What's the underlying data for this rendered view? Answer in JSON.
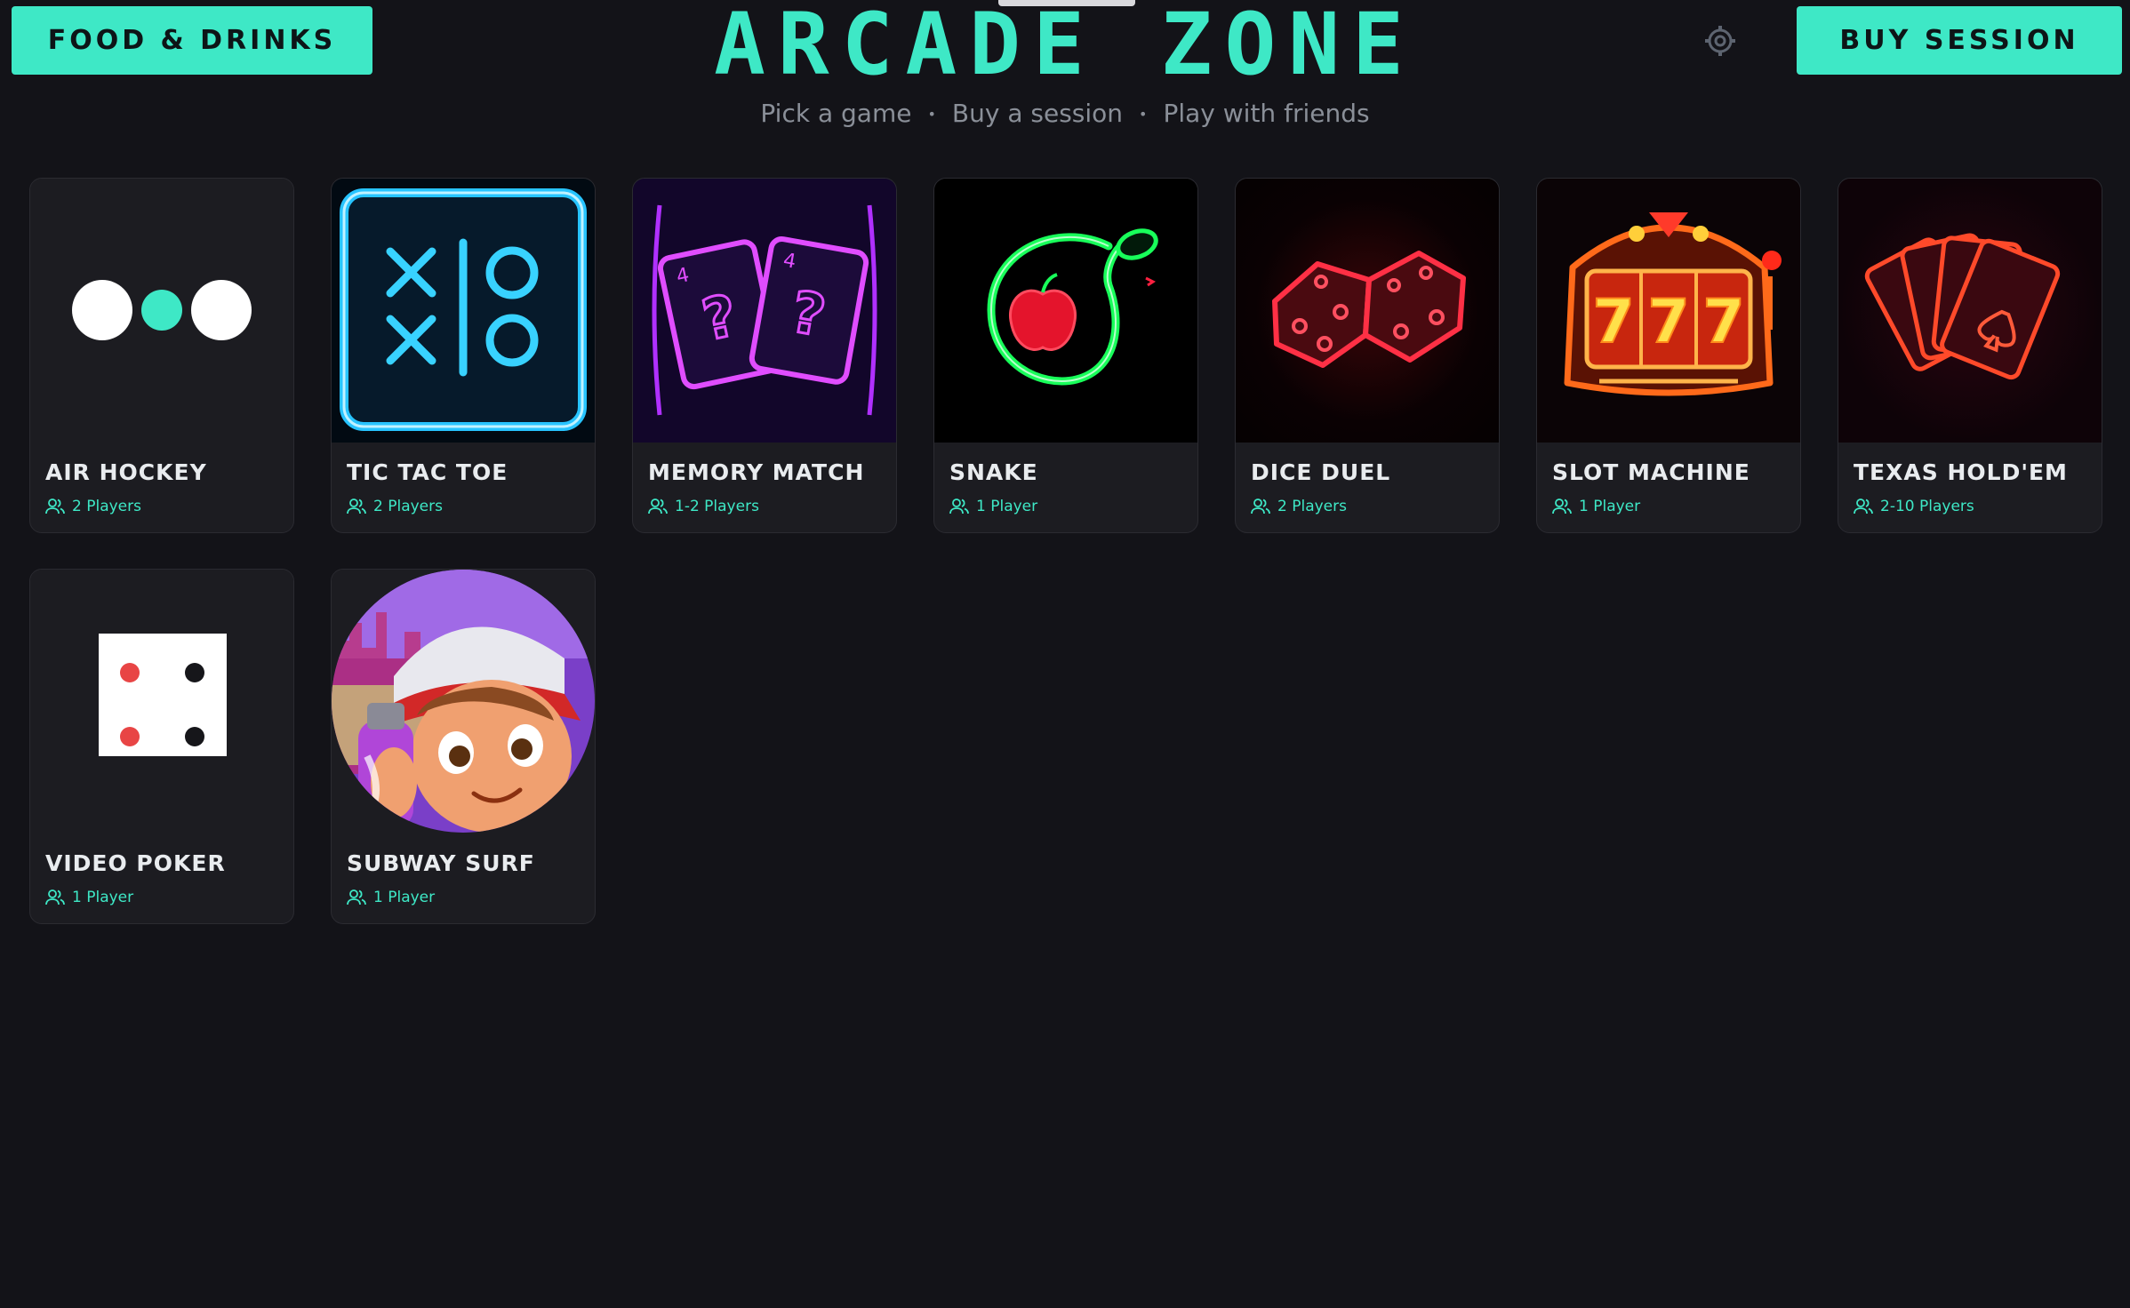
{
  "header": {
    "title": "ARCADE ZONE",
    "subtitle": [
      "Pick a game",
      "Buy a session",
      "Play with friends"
    ],
    "food_button": "FOOD & DRINKS",
    "buy_button": "BUY SESSION",
    "settings_icon": "gear-icon"
  },
  "colors": {
    "accent": "#3ee8c6",
    "background": "#131318",
    "card": "#1c1c21"
  },
  "games": [
    {
      "title": "AIR HOCKEY",
      "players": "2 Players",
      "icon": "air-hockey-icon"
    },
    {
      "title": "TIC TAC TOE",
      "players": "2 Players",
      "icon": "tic-tac-toe-icon"
    },
    {
      "title": "MEMORY MATCH",
      "players": "1-2 Players",
      "icon": "memory-cards-icon"
    },
    {
      "title": "SNAKE",
      "players": "1 Player",
      "icon": "snake-icon"
    },
    {
      "title": "DICE DUEL",
      "players": "2 Players",
      "icon": "dice-icon"
    },
    {
      "title": "SLOT MACHINE",
      "players": "1 Player",
      "icon": "slot-machine-icon"
    },
    {
      "title": "TEXAS HOLD'EM",
      "players": "2-10 Players",
      "icon": "playing-cards-icon"
    },
    {
      "title": "VIDEO POKER",
      "players": "1 Player",
      "icon": "die-face-icon"
    },
    {
      "title": "SUBWAY SURF",
      "players": "1 Player",
      "icon": "subway-surfer-character-icon"
    }
  ]
}
